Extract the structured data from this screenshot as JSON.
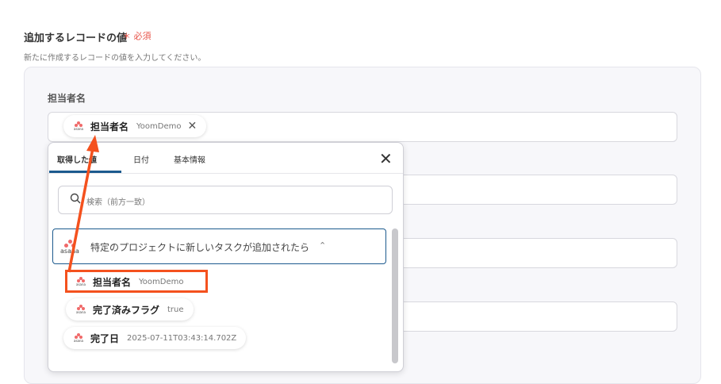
{
  "section": {
    "title": "追加するレコードの値",
    "required": "＊ 必須",
    "description": "新たに作成するレコードの値を入力してください。"
  },
  "field": {
    "label": "担当者名",
    "chip": {
      "label": "担当者名",
      "value": "YoomDemo",
      "remove_icon": "close-icon"
    }
  },
  "popup": {
    "tabs": [
      {
        "label": "取得した値",
        "active": true
      },
      {
        "label": "日付",
        "active": false
      },
      {
        "label": "基本情報",
        "active": false
      }
    ],
    "close_icon": "close-icon",
    "search": {
      "placeholder": "検索（前方一致）",
      "icon": "search-icon"
    },
    "group": {
      "app_icon": "asana-icon",
      "app_wordmark": "asana",
      "title": "特定のプロジェクトに新しいタスクが追加されたら",
      "expanded": true,
      "chevron_icon": "chevron-up-icon"
    },
    "items": [
      {
        "label": "担当者名",
        "value": "YoomDemo",
        "highlighted": true
      },
      {
        "label": "完了済みフラグ",
        "value": "true",
        "highlighted": false
      },
      {
        "label": "完了日",
        "value": "2025-07-11T03:43:14.702Z",
        "highlighted": false
      }
    ]
  },
  "colors": {
    "accent": "#1c5a8e",
    "required": "#e8564c",
    "annotation": "#f4511e",
    "asana": "#f06a6a"
  },
  "annotation": {
    "type": "arrow",
    "from": "popup-item-assignee",
    "to": "field-chip"
  }
}
